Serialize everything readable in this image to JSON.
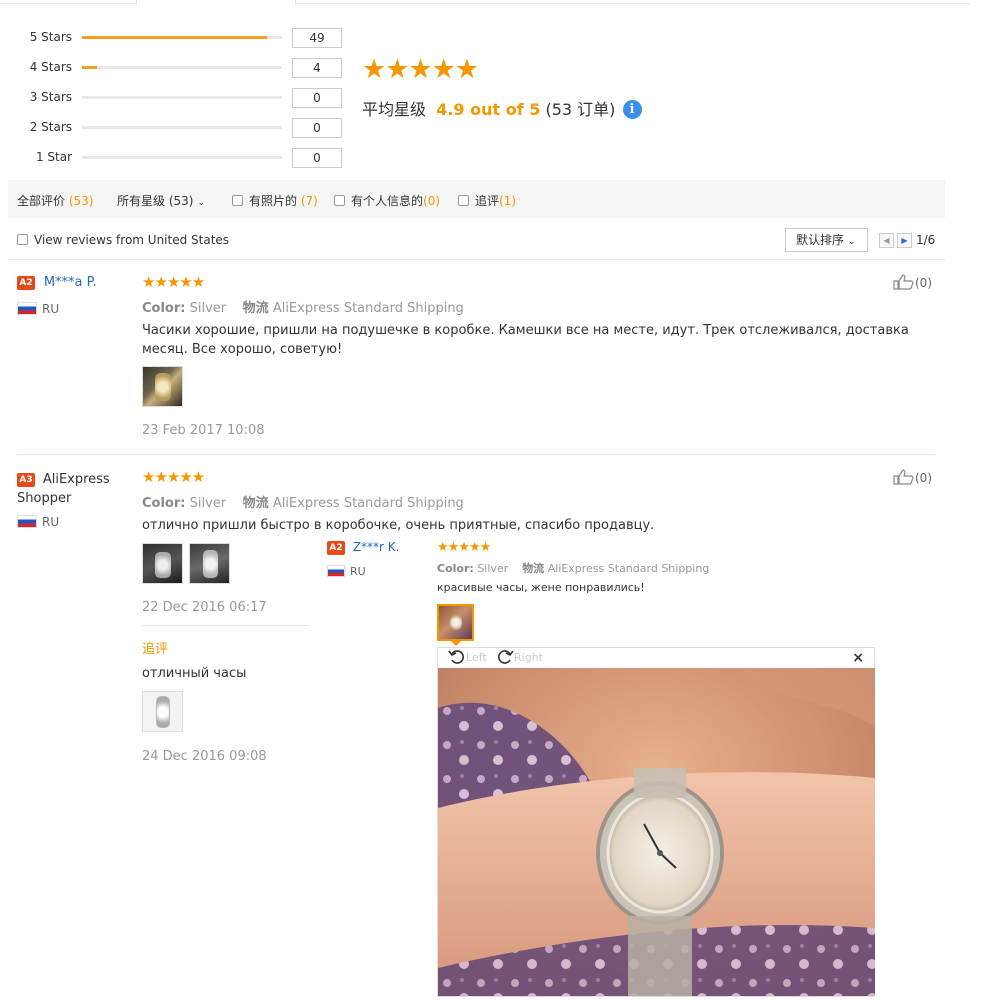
{
  "histogram": [
    {
      "label": "5 Stars",
      "count": "49",
      "fraction": 0.925
    },
    {
      "label": "4 Stars",
      "count": "4",
      "fraction": 0.075
    },
    {
      "label": "3 Stars",
      "count": "0",
      "fraction": 0
    },
    {
      "label": "2 Stars",
      "count": "0",
      "fraction": 0
    },
    {
      "label": "1 Star",
      "count": "0",
      "fraction": 0
    }
  ],
  "summary": {
    "stars": "★★★★★",
    "label": "平均星级",
    "rating": "4.9 out of 5",
    "orders_prefix": " (53 ",
    "orders_unit": "订单",
    "orders_suffix": ")",
    "info_icon": "info-icon"
  },
  "filters": {
    "all": "全部评价",
    "all_count": "(53)",
    "all_stars": "所有星级",
    "all_stars_count": "(53)",
    "with_photos": "有照片的",
    "with_photos_count": "(7)",
    "personal_info": "有个人信息的",
    "personal_info_count": "(0)",
    "follow_up": "追评",
    "follow_up_count": "(1)"
  },
  "view_us": "View reviews from United States",
  "sort": {
    "label": "默认排序"
  },
  "pager": {
    "text": "1/6"
  },
  "reviews": [
    {
      "badge": "A2",
      "name": "M***a P.",
      "country": "RU",
      "stars": "★★★★★",
      "color_label": "Color:",
      "color_value": "Silver",
      "ship_label": "物流",
      "ship_value": "AliExpress Standard Shipping",
      "text": "Часики хорошие, пришли на подушечке в коробке. Камешки все на месте, идут. Трек отслеживался, доставка месяц. Все хорошо, советую!",
      "date": "23 Feb 2017 10:08",
      "likes": "(0)"
    },
    {
      "badge": "A3",
      "name": "AliExpress Shopper",
      "country": "RU",
      "stars": "★★★★★",
      "color_label": "Color:",
      "color_value": "Silver",
      "ship_label": "物流",
      "ship_value": "AliExpress Standard Shipping",
      "text": "отлично пришли быстро в коробочке, очень приятные, спасибо продавцу.",
      "date": "22 Dec 2016 06:17",
      "followup_label": "追评",
      "followup_text": "отличный часы",
      "followup_date": "24 Dec 2016 09:08",
      "likes": "(0)"
    }
  ],
  "overlay_review": {
    "badge": "A2",
    "name": "Z***r K.",
    "country": "RU",
    "stars": "★★★★★",
    "color_label": "Color:",
    "color_value": "Silver",
    "ship_label": "物流",
    "ship_value": "AliExpress Standard Shipping",
    "text": "красивые часы, жене понравились!"
  },
  "viewer": {
    "left_label": "Left",
    "right_label": "Right",
    "close": "×"
  },
  "colors": {
    "accent": "#f39800",
    "link": "#2469c2",
    "badge": "#e64a19"
  }
}
